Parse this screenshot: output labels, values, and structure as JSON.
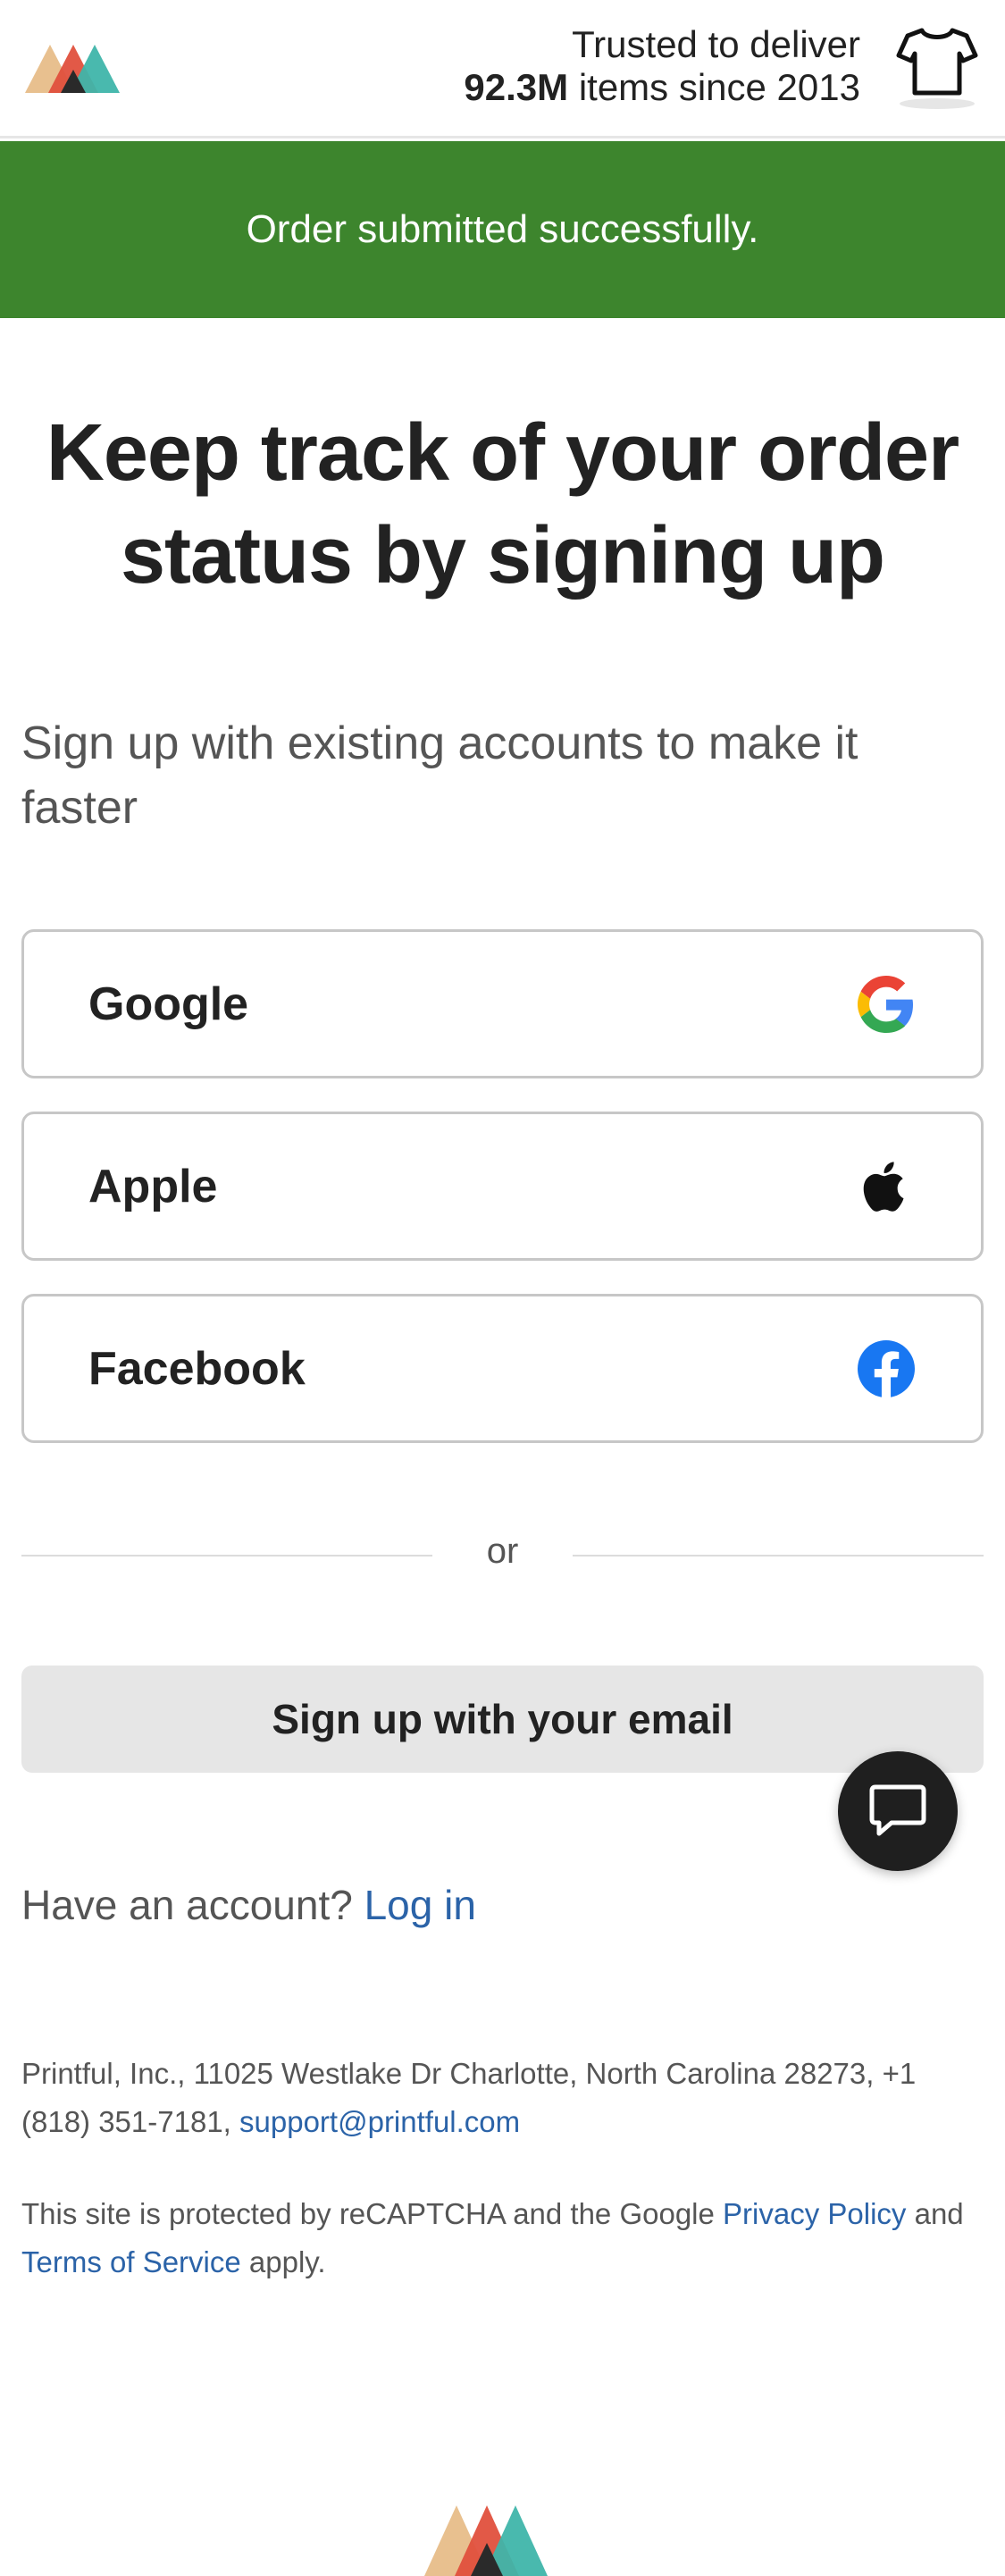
{
  "header": {
    "trust_line1": "Trusted to deliver",
    "trust_count": "92.3M",
    "trust_line2_rest": " items since 2013",
    "logo_icon": "printful-mountains-logo",
    "shirt_icon": "t-shirt-icon"
  },
  "banner": {
    "message": "Order submitted successfully.",
    "color": "#3d852d"
  },
  "main": {
    "title": "Keep track of your order status by signing up",
    "subtitle": "Sign up with existing accounts to make it faster",
    "social_buttons": [
      {
        "label": "Google",
        "icon": "google-icon"
      },
      {
        "label": "Apple",
        "icon": "apple-icon"
      },
      {
        "label": "Facebook",
        "icon": "facebook-icon"
      }
    ],
    "divider_text": "or",
    "email_button": "Sign up with your email",
    "have_account": "Have an account?",
    "login_link": "Log in"
  },
  "footer": {
    "address": "Printful, Inc., 11025 Westlake Dr Charlotte, North Carolina 28273, +1 (818) 351-7181, ",
    "support_email": "support@printful.com",
    "captcha_prefix": "This site is protected by reCAPTCHA and the Google ",
    "privacy_link": "Privacy Policy",
    "captcha_middle": " and ",
    "terms_link": "Terms of Service",
    "captcha_suffix": " apply."
  },
  "colors": {
    "link": "#2b63a8",
    "success_banner": "#3d852d",
    "chat_button": "#1f1f1f"
  }
}
